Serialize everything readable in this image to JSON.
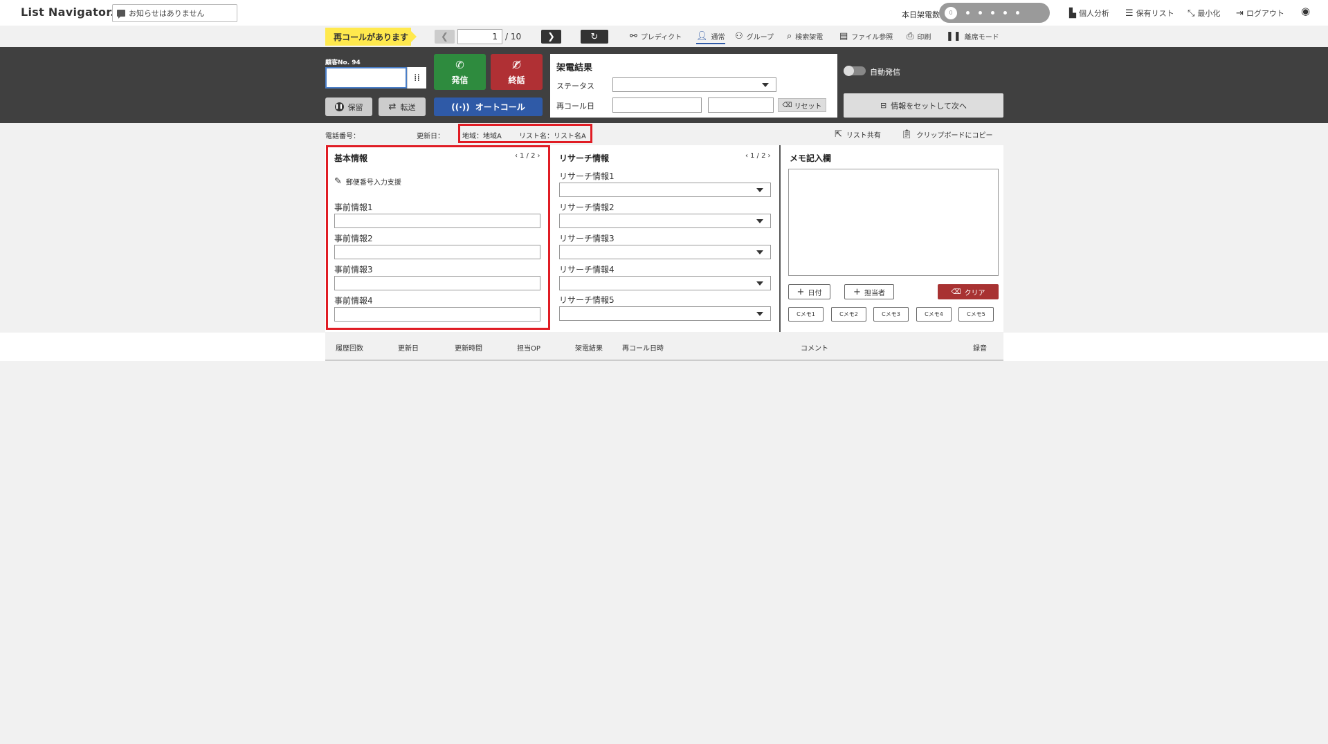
{
  "app": {
    "logo": "List Navigator."
  },
  "notice": {
    "text": "お知らせはありません"
  },
  "call_count": {
    "label": "本日架電数",
    "value": "0"
  },
  "top_nav": [
    {
      "label": "個人分析",
      "icon": "chart-icon"
    },
    {
      "label": "保有リスト",
      "icon": "list-icon"
    },
    {
      "label": "最小化",
      "icon": "minimize-icon"
    },
    {
      "label": "ログアウト",
      "icon": "logout-icon"
    }
  ],
  "recall_badge": "再コールがあります",
  "pager": {
    "current": "1",
    "total": "/ 10"
  },
  "sub_nav": [
    {
      "label": "プレディクト",
      "icon": "share-icon"
    },
    {
      "label": "通常",
      "icon": "person-icon"
    },
    {
      "label": "グループ",
      "icon": "group-icon"
    },
    {
      "label": "検索架電",
      "icon": "search-icon"
    },
    {
      "label": "ファイル参照",
      "icon": "file-icon"
    },
    {
      "label": "印刷",
      "icon": "print-icon"
    },
    {
      "label": "離席モード",
      "icon": "pause-icon"
    }
  ],
  "customer": {
    "number_label": "顧客No. 94",
    "phone_value": ""
  },
  "buttons": {
    "call": "発信",
    "hangup": "終話",
    "hold": "保留",
    "transfer": "転送",
    "autocall": "オートコール",
    "set_next": "情報をセットして次へ"
  },
  "call_result": {
    "title": "架電結果",
    "status_label": "ステータス",
    "status_value": "",
    "recall_label": "再コール日",
    "recall_date": "",
    "recall_time": "",
    "reset": "リセット"
  },
  "auto_dial": {
    "label": "自動発信",
    "enabled": false
  },
  "info_bar": {
    "phone_label": "電話番号：",
    "updated_label": "更新日：",
    "region": "地域：地域A",
    "list_name": "リスト名：リスト名A",
    "share": "リスト共有",
    "copy": "クリップボードにコピー"
  },
  "basic_info": {
    "title": "基本情報",
    "pager": "1 / 2",
    "postal_helper": "郵便番号入力支援",
    "fields": [
      {
        "label": "事前情報1",
        "value": ""
      },
      {
        "label": "事前情報2",
        "value": ""
      },
      {
        "label": "事前情報3",
        "value": ""
      },
      {
        "label": "事前情報4",
        "value": ""
      }
    ]
  },
  "research_info": {
    "title": "リサーチ情報",
    "pager": "1 / 2",
    "fields": [
      {
        "label": "リサーチ情報1",
        "value": ""
      },
      {
        "label": "リサーチ情報2",
        "value": ""
      },
      {
        "label": "リサーチ情報3",
        "value": ""
      },
      {
        "label": "リサーチ情報4",
        "value": ""
      },
      {
        "label": "リサーチ情報5",
        "value": ""
      }
    ]
  },
  "memo": {
    "title": "メモ記入欄",
    "value": "",
    "date_btn": "日付",
    "staff_btn": "担当者",
    "clear_btn": "クリア",
    "c_memos": [
      "Cメモ1",
      "Cメモ2",
      "Cメモ3",
      "Cメモ4",
      "Cメモ5"
    ]
  },
  "history": {
    "columns": [
      "履歴回数",
      "更新日",
      "更新時間",
      "担当OP",
      "架電結果",
      "再コール日時",
      "コメント",
      "録音"
    ]
  },
  "colors": {
    "call_green": "#2e8b3e",
    "hangup_red": "#b03034",
    "autocall_blue": "#2f5aa7",
    "dark_bar": "#404040",
    "recall_yellow": "#ffe94d",
    "highlight_red": "#e01c24"
  }
}
